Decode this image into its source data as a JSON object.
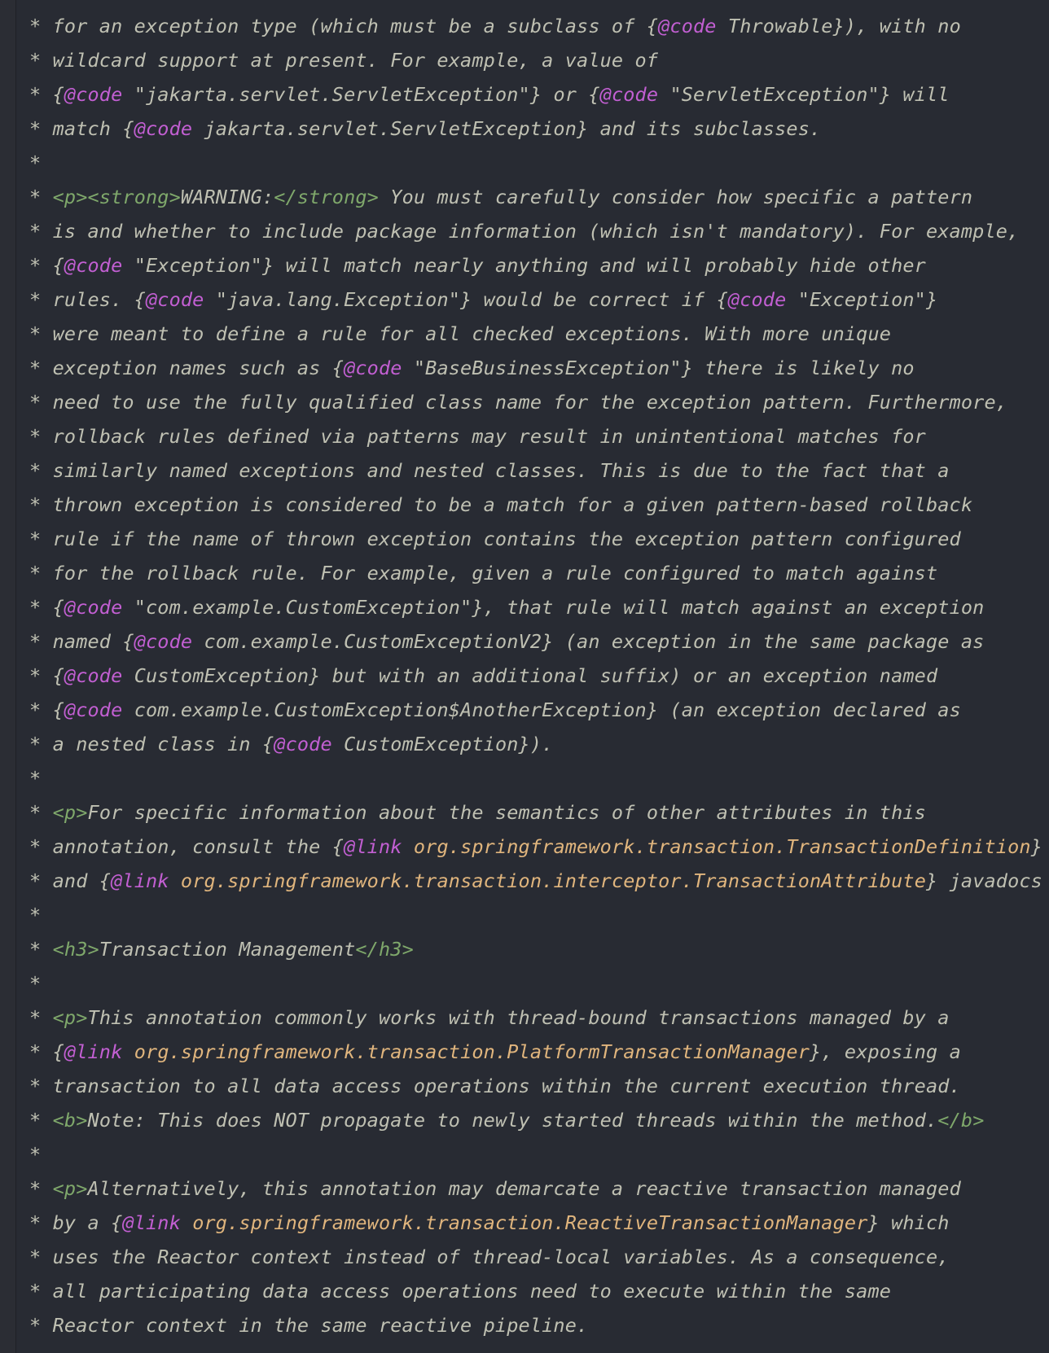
{
  "colors": {
    "background": "#282b33",
    "comment_text": "#bfc0b2",
    "html_tag": "#7fa86b",
    "javadoc_tag": "#c25fd2",
    "link_reference": "#e0b57d"
  },
  "lines": [
    [
      [
        "t",
        "* for an exception type (which must be a subclass of {"
      ],
      [
        "a",
        "@code"
      ],
      [
        "t",
        " Throwable}), with no"
      ]
    ],
    [
      [
        "t",
        "* wildcard support at present. For example, a value of"
      ]
    ],
    [
      [
        "t",
        "* {"
      ],
      [
        "a",
        "@code"
      ],
      [
        "t",
        " \"jakarta.servlet.ServletException\"} or {"
      ],
      [
        "a",
        "@code"
      ],
      [
        "t",
        " \"ServletException\"} will"
      ]
    ],
    [
      [
        "t",
        "* match {"
      ],
      [
        "a",
        "@code"
      ],
      [
        "t",
        " jakarta.servlet.ServletException} and its subclasses."
      ]
    ],
    [
      [
        "t",
        "*"
      ]
    ],
    [
      [
        "t",
        "* "
      ],
      [
        "g",
        "<p><strong>"
      ],
      [
        "t",
        "WARNING:"
      ],
      [
        "g",
        "</strong>"
      ],
      [
        "t",
        " You must carefully consider how specific a pattern"
      ]
    ],
    [
      [
        "t",
        "* is and whether to include package information (which isn't mandatory). For example,"
      ]
    ],
    [
      [
        "t",
        "* {"
      ],
      [
        "a",
        "@code"
      ],
      [
        "t",
        " \"Exception\"} will match nearly anything and will probably hide other"
      ]
    ],
    [
      [
        "t",
        "* rules. {"
      ],
      [
        "a",
        "@code"
      ],
      [
        "t",
        " \"java.lang.Exception\"} would be correct if {"
      ],
      [
        "a",
        "@code"
      ],
      [
        "t",
        " \"Exception\"}"
      ]
    ],
    [
      [
        "t",
        "* were meant to define a rule for all checked exceptions. With more unique"
      ]
    ],
    [
      [
        "t",
        "* exception names such as {"
      ],
      [
        "a",
        "@code"
      ],
      [
        "t",
        " \"BaseBusinessException\"} there is likely no"
      ]
    ],
    [
      [
        "t",
        "* need to use the fully qualified class name for the exception pattern. Furthermore,"
      ]
    ],
    [
      [
        "t",
        "* rollback rules defined via patterns may result in unintentional matches for"
      ]
    ],
    [
      [
        "t",
        "* similarly named exceptions and nested classes. This is due to the fact that a"
      ]
    ],
    [
      [
        "t",
        "* thrown exception is considered to be a match for a given pattern-based rollback"
      ]
    ],
    [
      [
        "t",
        "* rule if the name of thrown exception contains the exception pattern configured"
      ]
    ],
    [
      [
        "t",
        "* for the rollback rule. For example, given a rule configured to match against"
      ]
    ],
    [
      [
        "t",
        "* {"
      ],
      [
        "a",
        "@code"
      ],
      [
        "t",
        " \"com.example.CustomException\"}, that rule will match against an exception"
      ]
    ],
    [
      [
        "t",
        "* named {"
      ],
      [
        "a",
        "@code"
      ],
      [
        "t",
        " com.example.CustomExceptionV2} (an exception in the same package as"
      ]
    ],
    [
      [
        "t",
        "* {"
      ],
      [
        "a",
        "@code"
      ],
      [
        "t",
        " CustomException} but with an additional suffix) or an exception named"
      ]
    ],
    [
      [
        "t",
        "* {"
      ],
      [
        "a",
        "@code"
      ],
      [
        "t",
        " com.example.CustomException$AnotherException} (an exception declared as"
      ]
    ],
    [
      [
        "t",
        "* a nested class in {"
      ],
      [
        "a",
        "@code"
      ],
      [
        "t",
        " CustomException})."
      ]
    ],
    [
      [
        "t",
        "*"
      ]
    ],
    [
      [
        "t",
        "* "
      ],
      [
        "g",
        "<p>"
      ],
      [
        "t",
        "For specific information about the semantics of other attributes in this"
      ]
    ],
    [
      [
        "t",
        "* annotation, consult the {"
      ],
      [
        "a",
        "@link"
      ],
      [
        "t",
        " "
      ],
      [
        "r",
        "org.springframework.transaction.TransactionDefinition"
      ],
      [
        "t",
        "}"
      ]
    ],
    [
      [
        "t",
        "* and {"
      ],
      [
        "a",
        "@link"
      ],
      [
        "t",
        " "
      ],
      [
        "r",
        "org.springframework.transaction.interceptor.TransactionAttribute"
      ],
      [
        "t",
        "} javadocs"
      ]
    ],
    [
      [
        "t",
        "*"
      ]
    ],
    [
      [
        "t",
        "* "
      ],
      [
        "g",
        "<h3>"
      ],
      [
        "t",
        "Transaction Management"
      ],
      [
        "g",
        "</h3>"
      ]
    ],
    [
      [
        "t",
        "*"
      ]
    ],
    [
      [
        "t",
        "* "
      ],
      [
        "g",
        "<p>"
      ],
      [
        "t",
        "This annotation commonly works with thread-bound transactions managed by a"
      ]
    ],
    [
      [
        "t",
        "* {"
      ],
      [
        "a",
        "@link"
      ],
      [
        "t",
        " "
      ],
      [
        "r",
        "org.springframework.transaction.PlatformTransactionManager"
      ],
      [
        "t",
        "}, exposing a"
      ]
    ],
    [
      [
        "t",
        "* transaction to all data access operations within the current execution thread."
      ]
    ],
    [
      [
        "t",
        "* "
      ],
      [
        "g",
        "<b>"
      ],
      [
        "t",
        "Note: This does NOT propagate to newly started threads within the method."
      ],
      [
        "g",
        "</b>"
      ]
    ],
    [
      [
        "t",
        "*"
      ]
    ],
    [
      [
        "t",
        "* "
      ],
      [
        "g",
        "<p>"
      ],
      [
        "t",
        "Alternatively, this annotation may demarcate a reactive transaction managed"
      ]
    ],
    [
      [
        "t",
        "* by a {"
      ],
      [
        "a",
        "@link"
      ],
      [
        "t",
        " "
      ],
      [
        "r",
        "org.springframework.transaction.ReactiveTransactionManager"
      ],
      [
        "t",
        "} which"
      ]
    ],
    [
      [
        "t",
        "* uses the Reactor context instead of thread-local variables. As a consequence,"
      ]
    ],
    [
      [
        "t",
        "* all participating data access operations need to execute within the same"
      ]
    ],
    [
      [
        "t",
        "* Reactor context in the same reactive pipeline."
      ]
    ]
  ]
}
